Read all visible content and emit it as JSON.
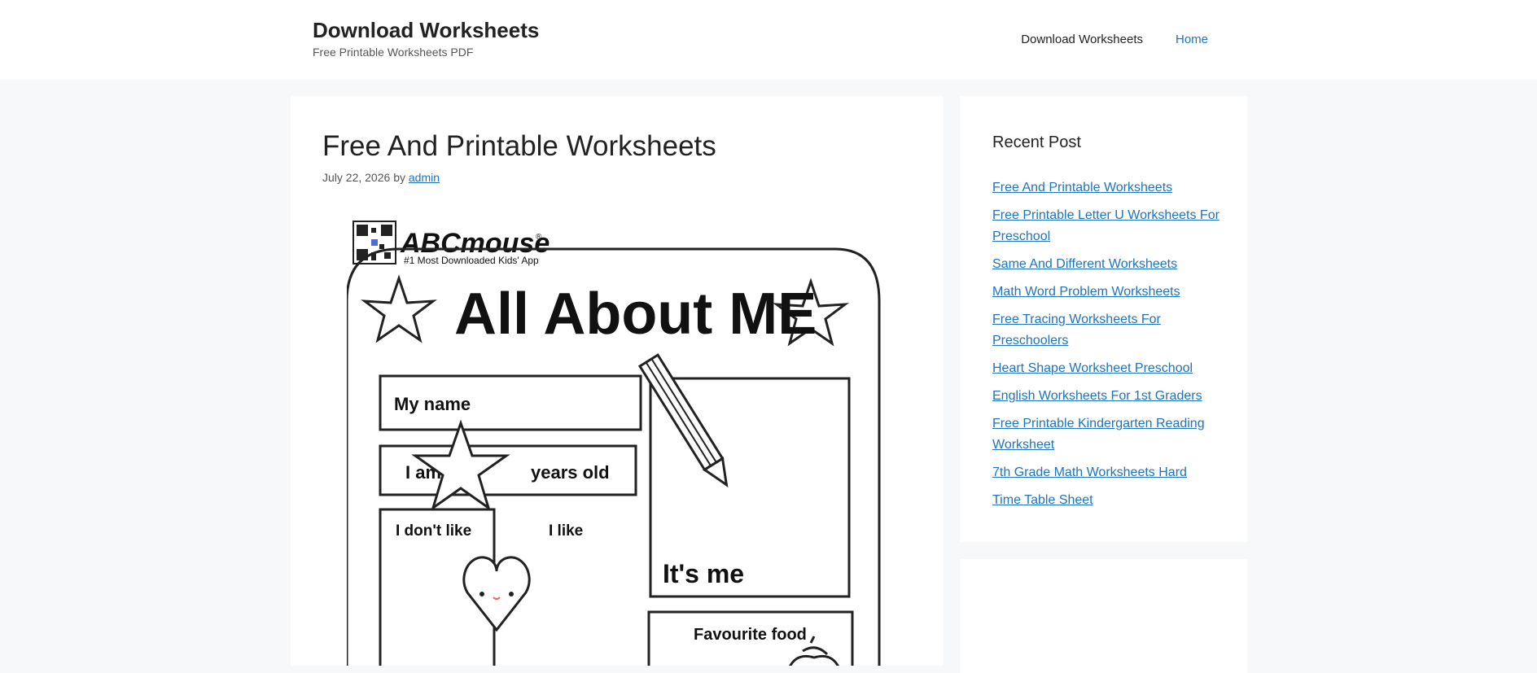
{
  "header": {
    "site_title": "Download Worksheets",
    "tagline": "Free Printable Worksheets PDF",
    "nav": [
      {
        "label": "Download Worksheets"
      },
      {
        "label": "Home"
      }
    ]
  },
  "post": {
    "title": "Free And Printable Worksheets",
    "date": "July 22, 2026",
    "by": "by",
    "author": "admin"
  },
  "worksheet": {
    "brand": "ABCmouse",
    "brand_mark": "®",
    "brand_tagline": "#1 Most Downloaded Kids' App",
    "heading": "All About ME",
    "my_name": "My name",
    "i_am": "I am",
    "years_old": "years old",
    "i_dont_like": "I don't like",
    "i_like": "I like",
    "its_me": "It's me",
    "favourite_food": "Favourite food"
  },
  "sidebar": {
    "title": "Recent Post",
    "items": [
      {
        "label": "Free And Printable Worksheets"
      },
      {
        "label": "Free Printable Letter U Worksheets For Preschool"
      },
      {
        "label": "Same And Different Worksheets"
      },
      {
        "label": "Math Word Problem Worksheets"
      },
      {
        "label": "Free Tracing Worksheets For Preschoolers"
      },
      {
        "label": "Heart Shape Worksheet Preschool"
      },
      {
        "label": "English Worksheets For 1st Graders"
      },
      {
        "label": "Free Printable Kindergarten Reading Worksheet"
      },
      {
        "label": "7th Grade Math Worksheets Hard"
      },
      {
        "label": "Time Table Sheet"
      }
    ]
  },
  "colors": {
    "link": "#1e73be",
    "background": "#f7f8f9",
    "text": "#222222"
  }
}
